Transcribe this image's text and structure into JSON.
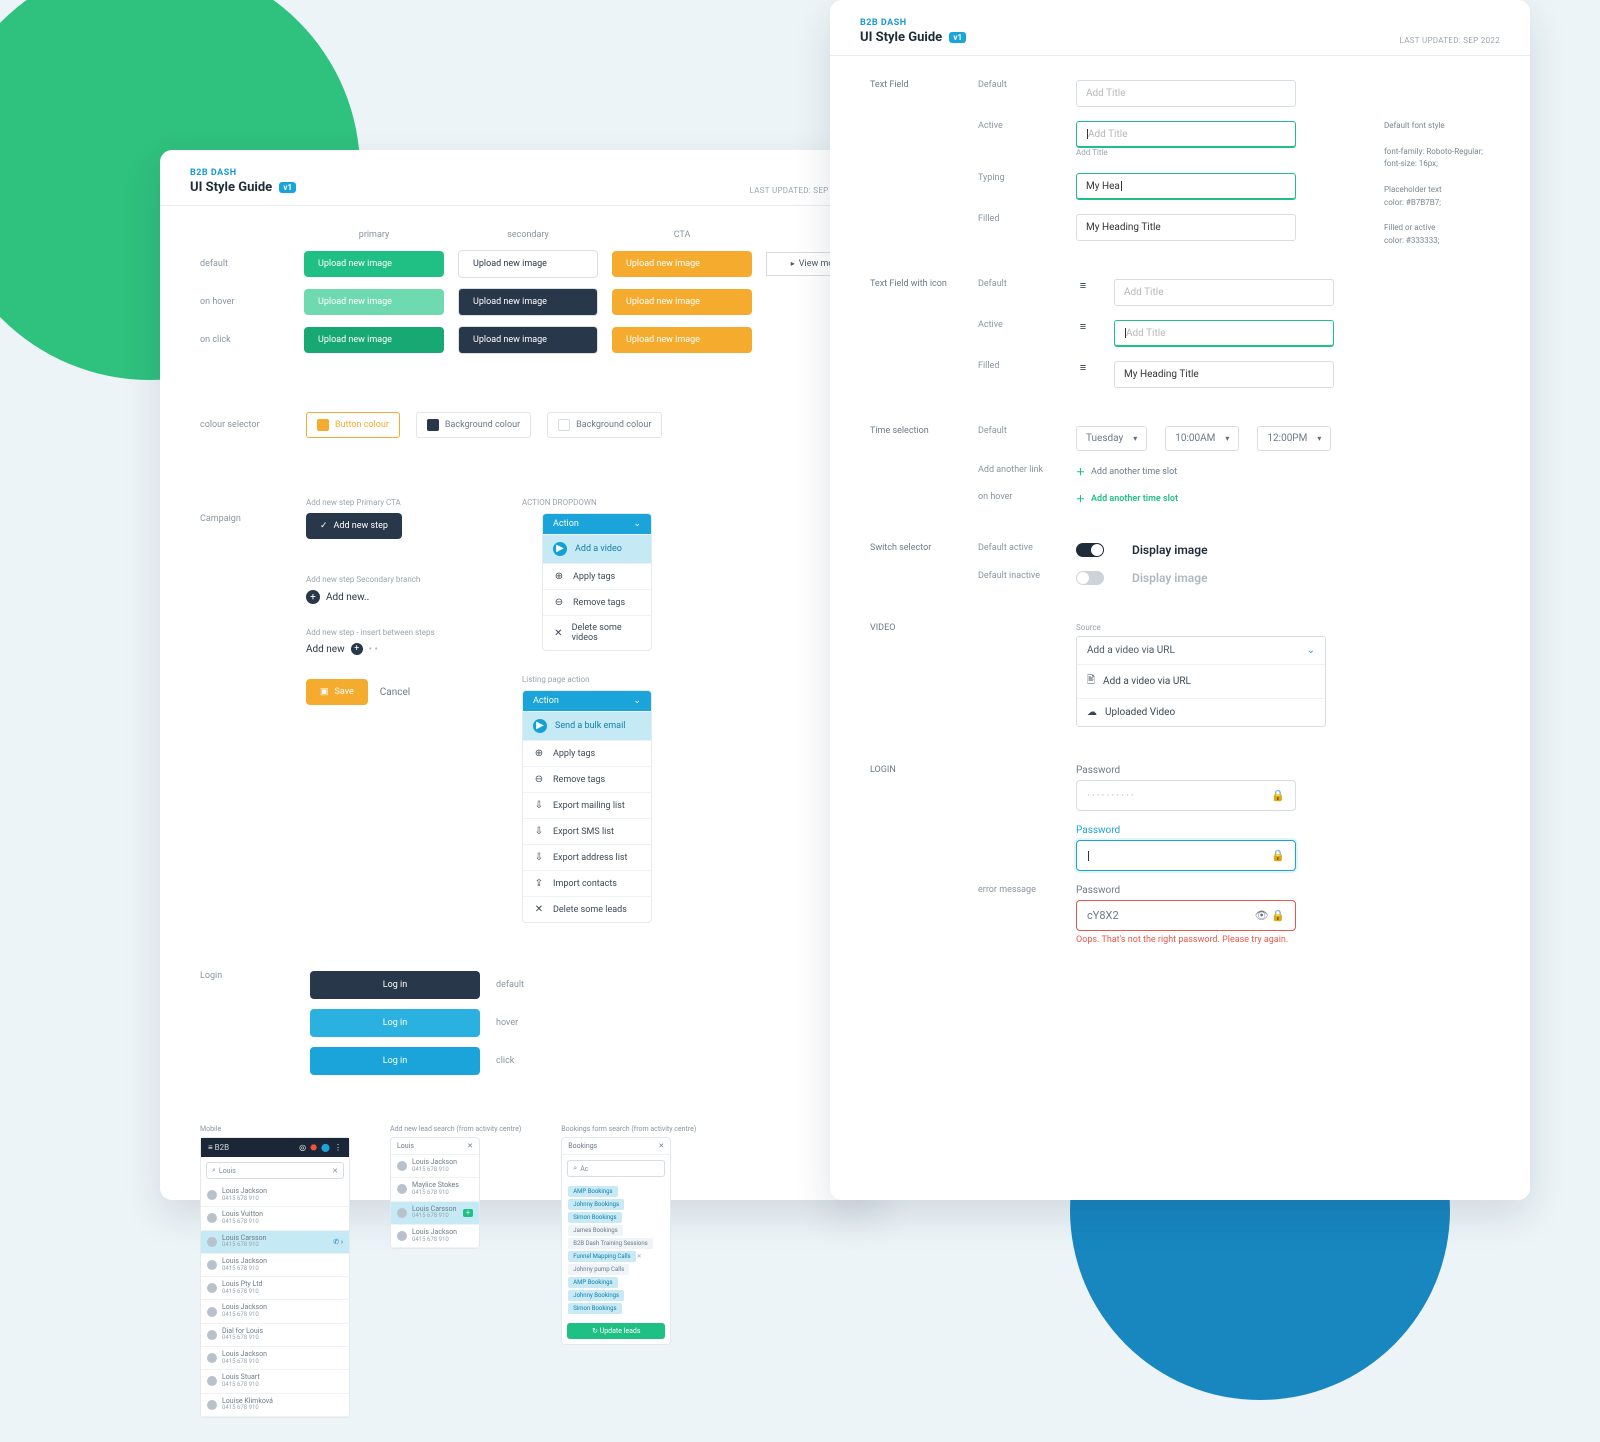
{
  "brand": "B2B DASH",
  "title": "UI Style Guide",
  "badge": "v1",
  "updated": "LAST UPDATED: SEP 2022",
  "left": {
    "cols": {
      "primary": "primary",
      "secondary": "secondary",
      "cta": "CTA"
    },
    "states": {
      "default": "default",
      "hover": "on hover",
      "click": "on click"
    },
    "btnLabel": "Upload new image",
    "viewmore": "View more",
    "colourSelector": "colour selector",
    "chips": {
      "button": "Button colour",
      "bg1": "Background colour",
      "bg2": "Background colour"
    },
    "campaign": "Campaign",
    "cta1Label": "Add new step Primary CTA",
    "addStep": "Add new step",
    "cta2Label": "Add new step Secondary branch",
    "addNew": "Add new..",
    "insertLabel": "Add new step - insert between steps",
    "insert": "Add new",
    "save": "Save",
    "cancel": "Cancel",
    "actionDropdown": "ACTION DROPDOWN",
    "action": "Action",
    "drop1": [
      "Add a video",
      "Apply tags",
      "Remove tags",
      "Delete some videos"
    ],
    "listingLabel": "Listing page action",
    "drop2": [
      "Send a bulk email",
      "Apply tags",
      "Remove tags",
      "Export mailing list",
      "Export SMS list",
      "Export address list",
      "Import contacts",
      "Delete some leads"
    ],
    "login": "Login",
    "loginBtn": "Log in",
    "loginStates": {
      "default": "default",
      "hover": "hover",
      "click": "click"
    },
    "mobiles": {
      "m1cap": "Mobile",
      "m2cap": "Add new lead search (from activity centre)",
      "m3cap": "Bookings form search (from activity centre)",
      "search": "Louis",
      "ac": "Ac",
      "bookings": "Bookings",
      "names": [
        "Louis Jackson",
        "Louis Vuitton",
        "Louis Carsson",
        "Maylice Stokes",
        "Louis Jackson",
        "Louis Carsson",
        "Louis Jackson",
        "Louis Pty Ltd",
        "Louis Jackson",
        "Dial for Louis",
        "Louis Jackson",
        "Louis Stuart",
        "Louise Klimková"
      ],
      "phone": "0415 678 910",
      "tags": [
        "AMP Bookings",
        "Johnny Bookings",
        "Simon Bookings",
        "James Bookings",
        "B2B Dash Training Sessions",
        "Funnel Mapping Calls",
        "Johnny pump Calls",
        "AMP Bookings",
        "Johnny Bookings",
        "Simon Bookings"
      ],
      "updateLeads": "Update leads"
    }
  },
  "right": {
    "textField": "Text Field",
    "textFieldIcon": "Text Field with icon",
    "default": "Default",
    "active": "Active",
    "typing": "Typing",
    "filled": "Filled",
    "placeholder": "Add Title",
    "floatLabel": "Add Title",
    "typed": "My Hea",
    "filledVal": "My Heading Title",
    "timeSel": "Time selection",
    "day": "Tuesday",
    "t1": "10:00AM",
    "t2": "12:00PM",
    "addAnother": "Add another link",
    "addSlot": "Add another time slot",
    "onhover": "on hover",
    "switch": "Switch selector",
    "defActive": "Default active",
    "defInactive": "Default inactive",
    "swLabel": "Display image",
    "video": "VIDEO",
    "source": "Source",
    "vHead": "Add a video via URL",
    "vItems": [
      "Add a video via URL",
      "Uploaded Video"
    ],
    "loginSec": "LOGIN",
    "pwLabel": "Password",
    "pwDots": "··········",
    "pwVal": "cY8X2",
    "errLabel": "error message",
    "errMsg": "Oops. That's not the right password. Please try again.",
    "annot": {
      "a": "Default font style",
      "b": "font-family: Roboto-Regular;",
      "c": "font-size: 16px;",
      "d": "Placeholder text",
      "e": "color: #B7B7B7;",
      "f": "Filled or active",
      "g": "color: #333333;"
    }
  }
}
